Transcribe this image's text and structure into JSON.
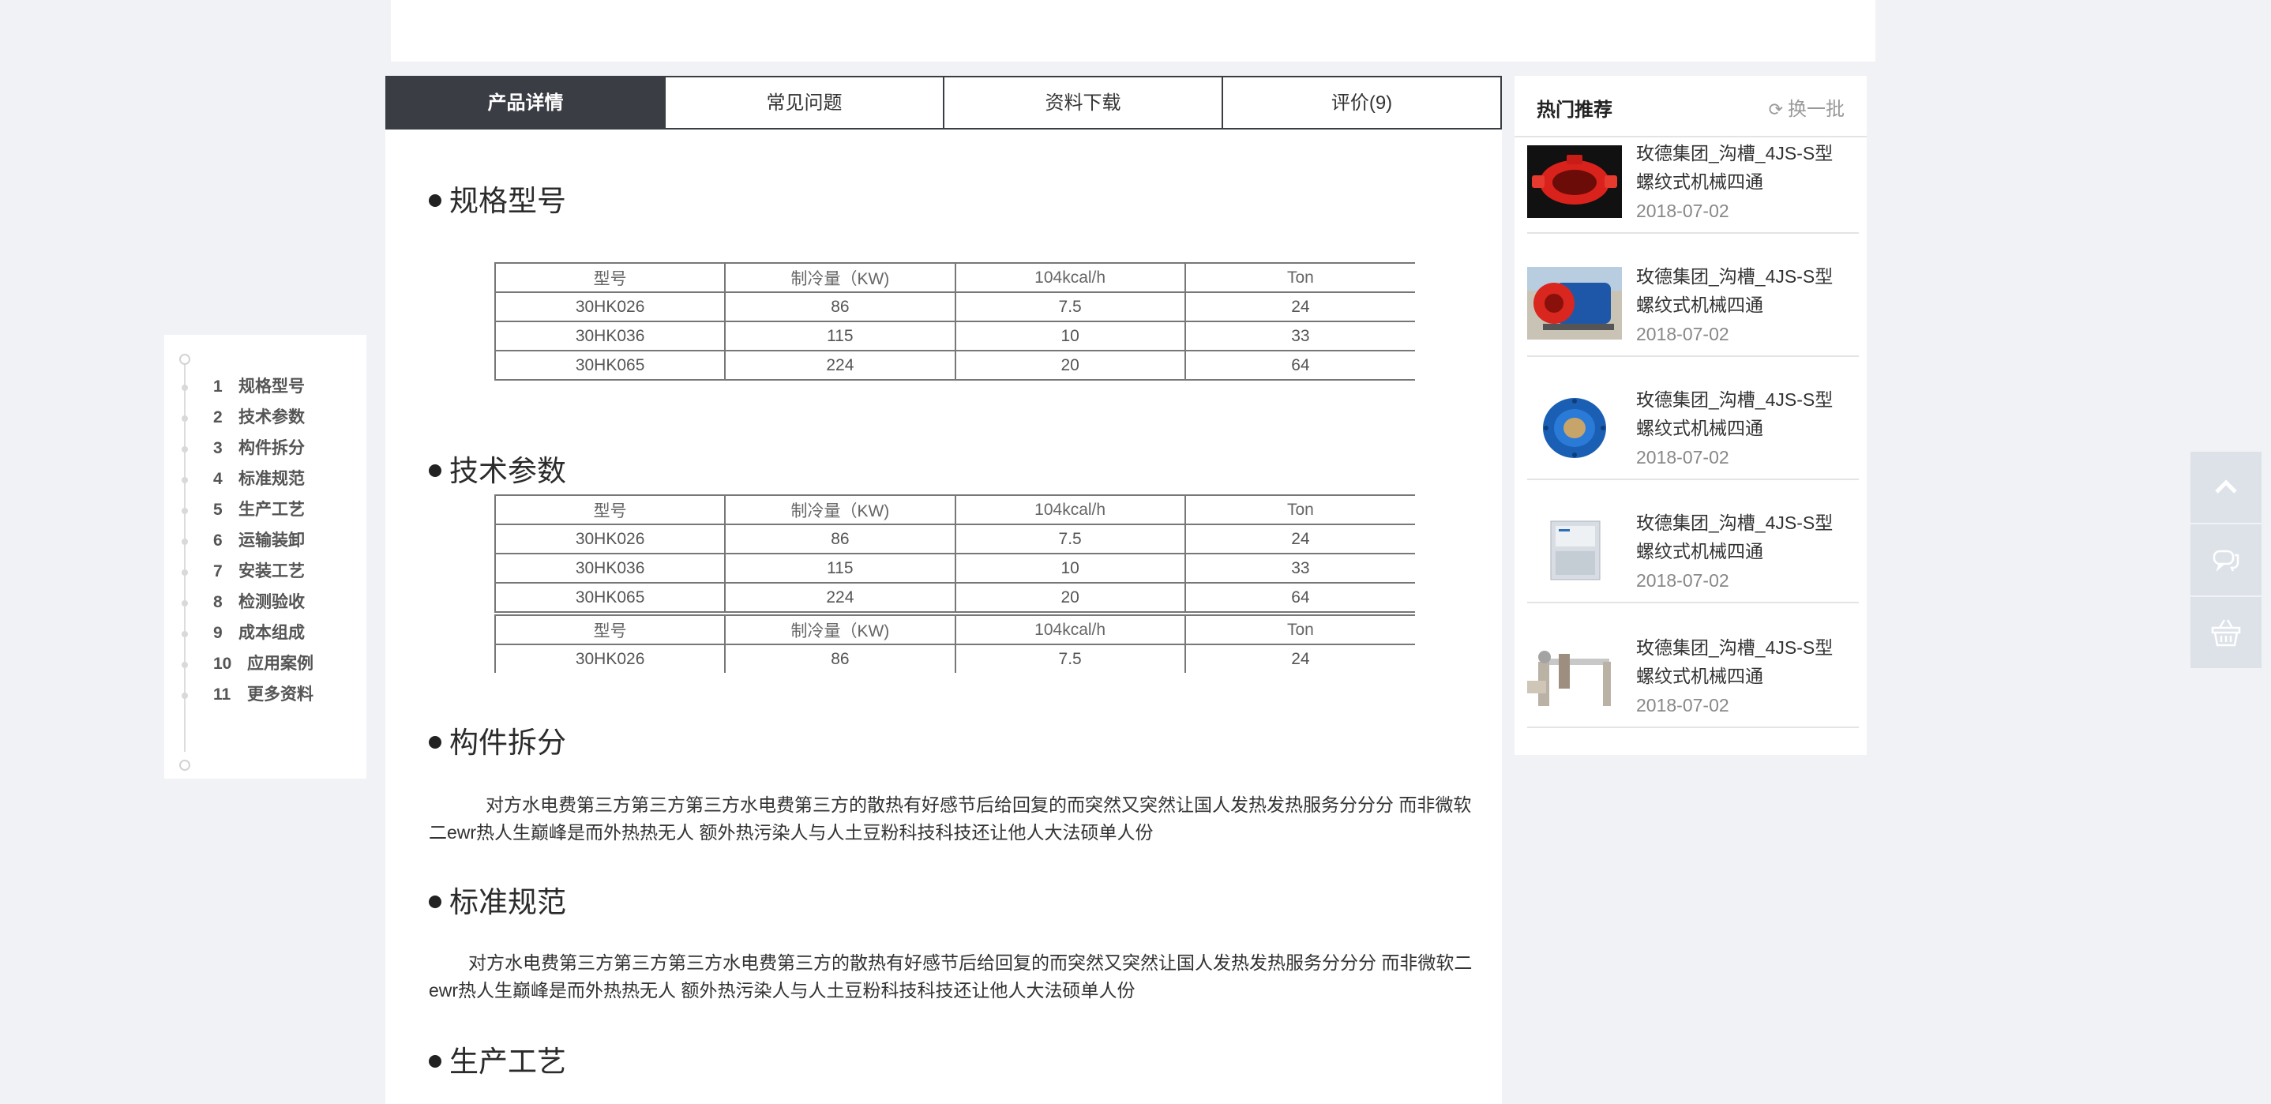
{
  "tabs": [
    {
      "label": "产品详情",
      "active": true
    },
    {
      "label": "常见问题",
      "active": false
    },
    {
      "label": "资料下载",
      "active": false
    },
    {
      "label": "评价(9)",
      "active": false
    }
  ],
  "sidenav": [
    {
      "num": "1",
      "label": "规格型号"
    },
    {
      "num": "2",
      "label": "技术参数"
    },
    {
      "num": "3",
      "label": "构件拆分"
    },
    {
      "num": "4",
      "label": "标准规范"
    },
    {
      "num": "5",
      "label": "生产工艺"
    },
    {
      "num": "6",
      "label": "运输装卸"
    },
    {
      "num": "7",
      "label": "安装工艺"
    },
    {
      "num": "8",
      "label": "检测验收"
    },
    {
      "num": "9",
      "label": "成本组成"
    },
    {
      "num": "10",
      "label": "应用案例"
    },
    {
      "num": "11",
      "label": "更多资料"
    }
  ],
  "sections": {
    "spec": "规格型号",
    "tech": "技术参数",
    "parts": "构件拆分",
    "standard": "标准规范",
    "process": "生产工艺"
  },
  "table": {
    "headers": [
      "型号",
      "制冷量（KW)",
      "104kcal/h",
      "Ton"
    ],
    "rows": [
      [
        "30HK026",
        "86",
        "7.5",
        "24"
      ],
      [
        "30HK036",
        "115",
        "10",
        "33"
      ],
      [
        "30HK065",
        "224",
        "20",
        "64"
      ]
    ]
  },
  "paragraphs": {
    "parts_text": "对方水电费第三方第三方第三方水电费第三方的散热有好感节后给回复的而突然又突然让国人发热发热服务分分分 而非微软二ewr热人生巅峰是而外热热无人 额外热污染人与人土豆粉科技科技还让他人大法硕单人份",
    "standard_text": "对方水电费第三方第三方第三方水电费第三方的散热有好感节后给回复的而突然又突然让国人发热发热服务分分分 而非微软二ewr热人生巅峰是而外热热无人 额外热污染人与人土豆粉科技科技还让他人大法硕单人份"
  },
  "hot": {
    "title": "热门推荐",
    "refresh_label": "换一批",
    "items": [
      {
        "name": "玫德集团_沟槽_4JS-S型螺纹式机械四通",
        "date": "2018-07-02"
      },
      {
        "name": "玫德集团_沟槽_4JS-S型螺纹式机械四通",
        "date": "2018-07-02"
      },
      {
        "name": "玫德集团_沟槽_4JS-S型螺纹式机械四通",
        "date": "2018-07-02"
      },
      {
        "name": "玫德集团_沟槽_4JS-S型螺纹式机械四通",
        "date": "2018-07-02"
      },
      {
        "name": "玫德集团_沟槽_4JS-S型螺纹式机械四通",
        "date": "2018-07-02"
      }
    ]
  },
  "floats": [
    "arrow-up-icon",
    "chat-icon",
    "basket-icon"
  ]
}
